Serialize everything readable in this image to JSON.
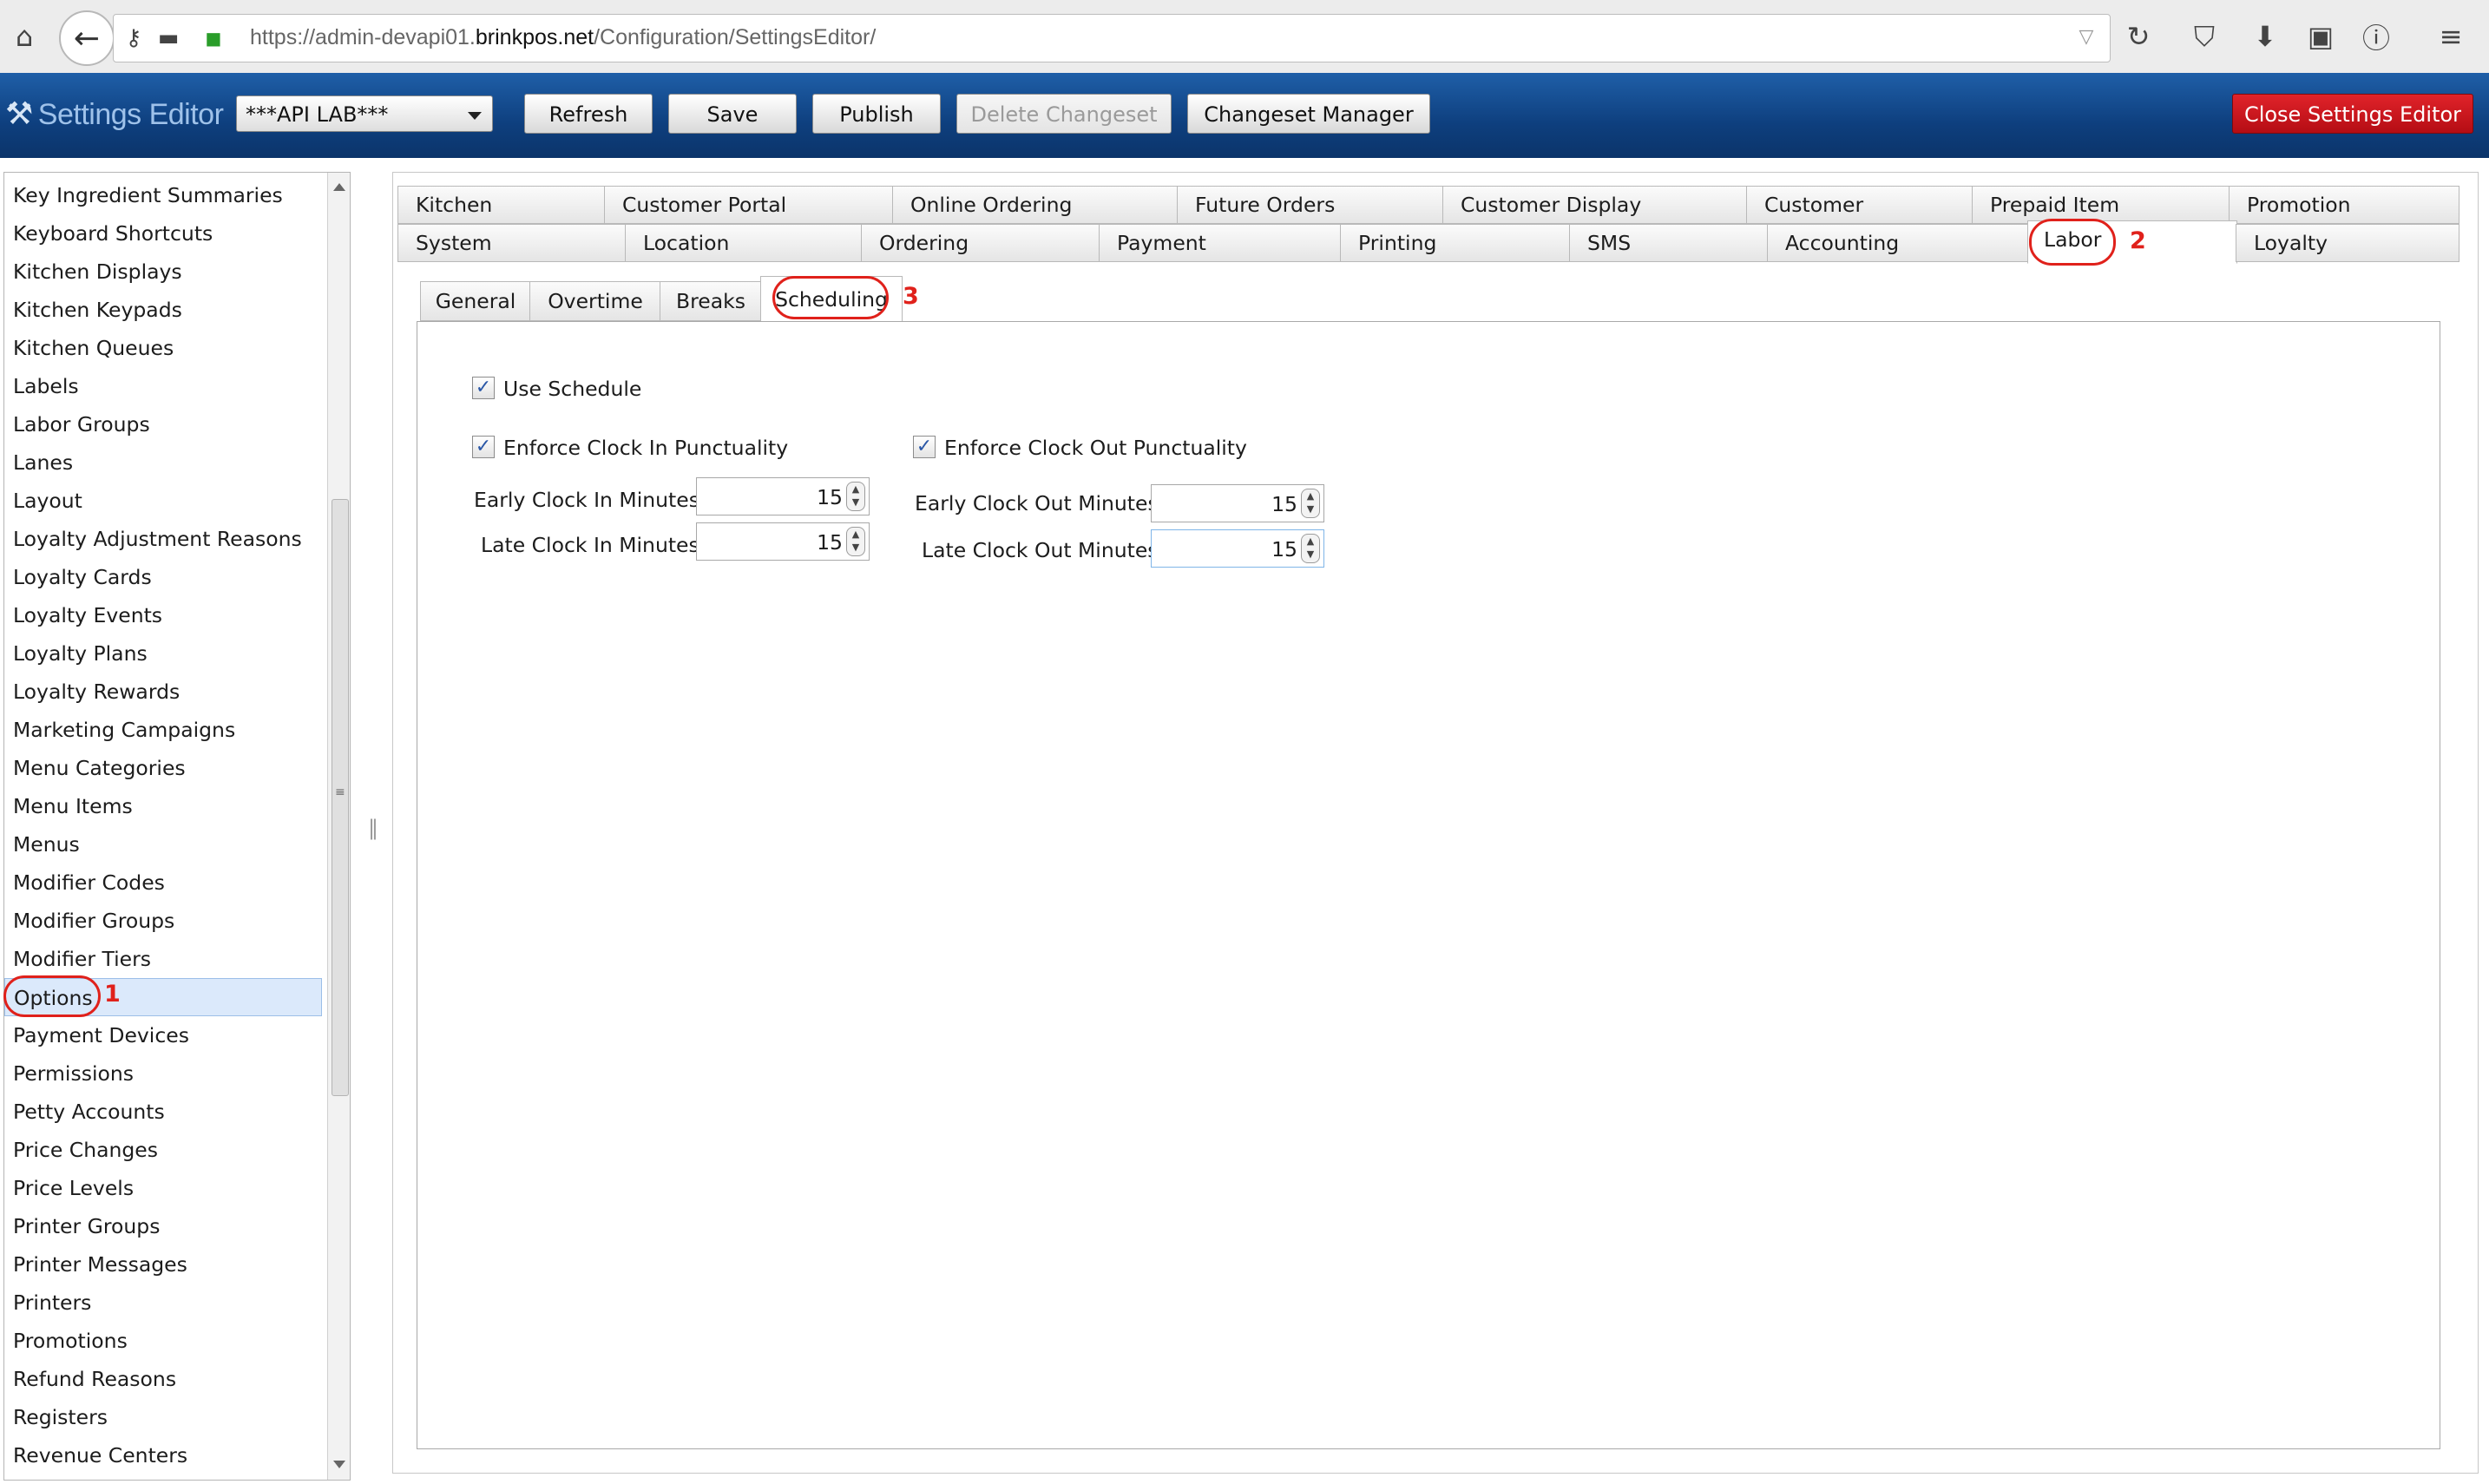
{
  "browser": {
    "url_prefix": "https://admin-devapi01.",
    "url_domain": "brinkpos.net",
    "url_path": "/Configuration/SettingsEditor/"
  },
  "header": {
    "logo": "Settings Editor",
    "config_select": "***API LAB***",
    "buttons": {
      "refresh": "Refresh",
      "save": "Save",
      "publish": "Publish",
      "delete_changeset": "Delete Changeset",
      "changeset_manager": "Changeset Manager",
      "close_editor": "Close Settings Editor"
    },
    "colors": {
      "header": "#0e3f7e",
      "close_button": "#c4141a"
    }
  },
  "sidebar": {
    "items": [
      "Key Ingredient Summaries",
      "Keyboard Shortcuts",
      "Kitchen Displays",
      "Kitchen Keypads",
      "Kitchen Queues",
      "Labels",
      "Labor Groups",
      "Lanes",
      "Layout",
      "Loyalty Adjustment Reasons",
      "Loyalty Cards",
      "Loyalty Events",
      "Loyalty Plans",
      "Loyalty Rewards",
      "Marketing Campaigns",
      "Menu Categories",
      "Menu Items",
      "Menus",
      "Modifier Codes",
      "Modifier Groups",
      "Modifier Tiers",
      "Options",
      "Payment Devices",
      "Permissions",
      "Petty Accounts",
      "Price Changes",
      "Price Levels",
      "Printer Groups",
      "Printer Messages",
      "Printers",
      "Promotions",
      "Refund Reasons",
      "Registers",
      "Revenue Centers"
    ],
    "selected": "Options"
  },
  "tabs": {
    "row1": [
      "Kitchen",
      "Customer Portal",
      "Online Ordering",
      "Future Orders",
      "Customer Display",
      "Customer",
      "Prepaid Item",
      "Promotion"
    ],
    "row2": [
      "System",
      "Location",
      "Ordering",
      "Payment",
      "Printing",
      "SMS",
      "Accounting",
      "Labor",
      "Loyalty"
    ],
    "active": "Labor"
  },
  "subtabs": {
    "items": [
      "General",
      "Overtime",
      "Breaks",
      "Scheduling"
    ],
    "active": "Scheduling"
  },
  "scheduling": {
    "use_schedule": {
      "label": "Use Schedule",
      "checked": true
    },
    "enforce_clock_in": {
      "label": "Enforce Clock In Punctuality",
      "checked": true
    },
    "enforce_clock_out": {
      "label": "Enforce Clock Out Punctuality",
      "checked": true
    },
    "early_clock_in": {
      "label": "Early Clock In Minutes",
      "value": "15"
    },
    "late_clock_in": {
      "label": "Late Clock In Minutes",
      "value": "15"
    },
    "early_clock_out": {
      "label": "Early Clock Out Minutes",
      "value": "15"
    },
    "late_clock_out": {
      "label": "Late Clock Out Minutes",
      "value": "15"
    }
  },
  "annotations": {
    "step1": "1",
    "step2": "2",
    "step3": "3"
  }
}
